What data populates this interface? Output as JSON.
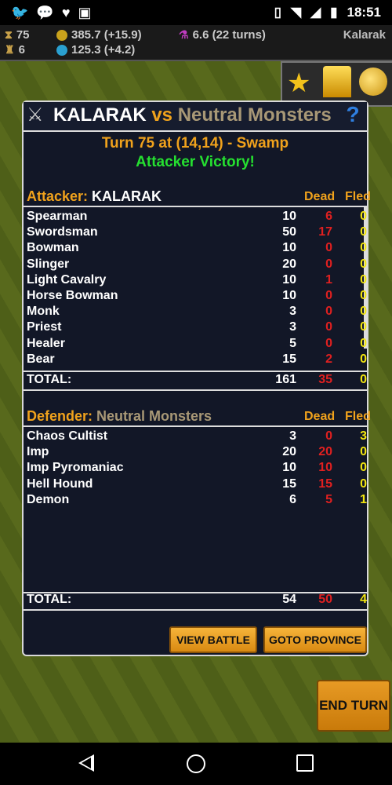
{
  "status_bar": {
    "time": "18:51"
  },
  "resources": {
    "turn": "75",
    "gold": "385.7 (+15.9)",
    "mana": "6.6 (22 turns)",
    "cities": "6",
    "gems": "125.3 (+4.2)",
    "player": "Kalarak"
  },
  "dialog": {
    "attacker_title": "KALARAK",
    "vs": "vs",
    "defender_title": "Neutral Monsters",
    "help": "?",
    "turn_line": "Turn 75 at (14,14) - Swamp",
    "result": "Attacker Victory!",
    "attacker": {
      "label": "Attacker:",
      "name": "KALARAK",
      "col_dead": "Dead",
      "col_fled": "Fled",
      "units": [
        {
          "name": "Spearman",
          "count": "10",
          "dead": "6",
          "fled": "0"
        },
        {
          "name": "Swordsman",
          "count": "50",
          "dead": "17",
          "fled": "0"
        },
        {
          "name": "Bowman",
          "count": "10",
          "dead": "0",
          "fled": "0"
        },
        {
          "name": "Slinger",
          "count": "20",
          "dead": "0",
          "fled": "0"
        },
        {
          "name": "Light Cavalry",
          "count": "10",
          "dead": "1",
          "fled": "0"
        },
        {
          "name": "Horse Bowman",
          "count": "10",
          "dead": "0",
          "fled": "0"
        },
        {
          "name": "Monk",
          "count": "3",
          "dead": "0",
          "fled": "0"
        },
        {
          "name": "Priest",
          "count": "3",
          "dead": "0",
          "fled": "0"
        },
        {
          "name": "Healer",
          "count": "5",
          "dead": "0",
          "fled": "0"
        },
        {
          "name": "Bear",
          "count": "15",
          "dead": "2",
          "fled": "0"
        }
      ],
      "total_label": "TOTAL:",
      "total_count": "161",
      "total_dead": "35",
      "total_fled": "0"
    },
    "defender": {
      "label": "Defender:",
      "name": "Neutral Monsters",
      "col_dead": "Dead",
      "col_fled": "Fled",
      "units": [
        {
          "name": "Chaos Cultist",
          "count": "3",
          "dead": "0",
          "fled": "3"
        },
        {
          "name": "Imp",
          "count": "20",
          "dead": "20",
          "fled": "0"
        },
        {
          "name": "Imp Pyromaniac",
          "count": "10",
          "dead": "10",
          "fled": "0"
        },
        {
          "name": "Hell Hound",
          "count": "15",
          "dead": "15",
          "fled": "0"
        },
        {
          "name": "Demon",
          "count": "6",
          "dead": "5",
          "fled": "1"
        }
      ],
      "total_label": "TOTAL:",
      "total_count": "54",
      "total_dead": "50",
      "total_fled": "4"
    },
    "buttons": {
      "view_battle": "VIEW BATTLE",
      "goto_province": "GOTO PROVINCE"
    }
  },
  "end_turn": "END TURN"
}
